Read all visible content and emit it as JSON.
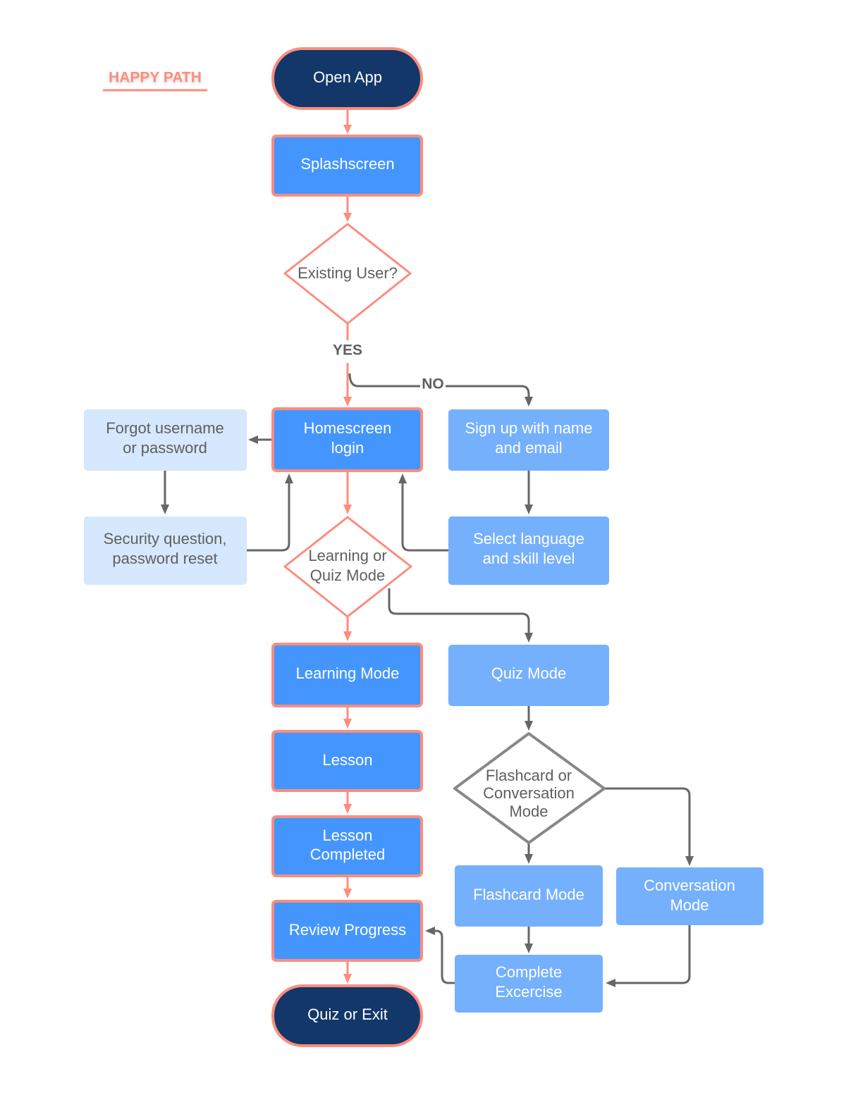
{
  "colors": {
    "happy_path": "#fc8d7e",
    "terminal_fill": "#133769",
    "primary_fill": "#4496fe",
    "secondary_fill": "#75b0fd",
    "pale_fill": "#d5e8fe",
    "connector_gray": "#666666",
    "text_gray": "#5f5f5f"
  },
  "legend": {
    "label": "HAPPY PATH"
  },
  "nodes": {
    "open_app": {
      "lines": [
        "Open App"
      ]
    },
    "splashscreen": {
      "lines": [
        "Splashscreen"
      ]
    },
    "existing_user": {
      "lines": [
        "Existing User?"
      ]
    },
    "homescreen_login": {
      "lines": [
        "Homescreen",
        "login"
      ]
    },
    "forgot": {
      "lines": [
        "Forgot username",
        "or password"
      ]
    },
    "security": {
      "lines": [
        "Security question,",
        "password reset"
      ]
    },
    "signup": {
      "lines": [
        "Sign up with name",
        "and email"
      ]
    },
    "select_language": {
      "lines": [
        "Select language",
        "and skill level"
      ]
    },
    "learning_or_quiz": {
      "lines": [
        "Learning or",
        "Quiz Mode"
      ]
    },
    "learning_mode": {
      "lines": [
        "Learning Mode"
      ]
    },
    "quiz_mode": {
      "lines": [
        "Quiz Mode"
      ]
    },
    "lesson": {
      "lines": [
        "Lesson"
      ]
    },
    "lesson_completed": {
      "lines": [
        "Lesson",
        "Completed"
      ]
    },
    "flashcard_or_conversation": {
      "lines": [
        "Flashcard or",
        "Conversation",
        "Mode"
      ]
    },
    "flashcard_mode": {
      "lines": [
        "Flashcard Mode"
      ]
    },
    "conversation_mode": {
      "lines": [
        "Conversation",
        "Mode"
      ]
    },
    "review_progress": {
      "lines": [
        "Review Progress"
      ]
    },
    "complete_exercise": {
      "lines": [
        "Complete",
        "Excercise"
      ]
    },
    "quiz_or_exit": {
      "lines": [
        "Quiz or Exit"
      ]
    }
  },
  "edge_labels": {
    "yes": "YES",
    "no": "NO"
  }
}
